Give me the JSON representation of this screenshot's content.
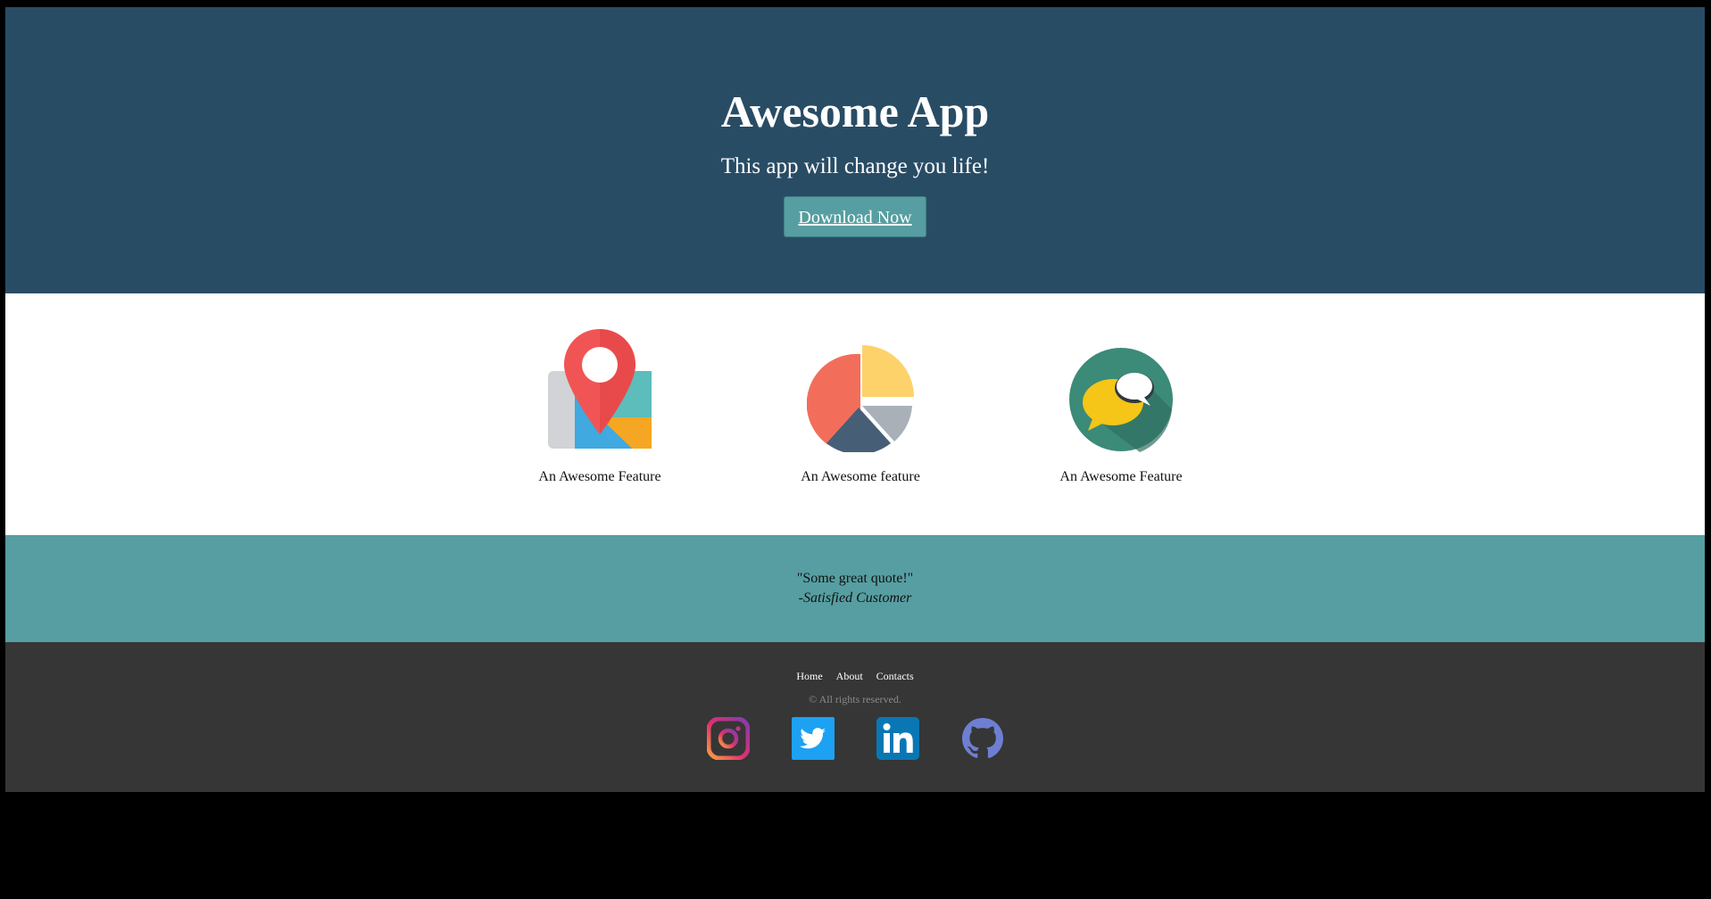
{
  "hero": {
    "title": "Awesome App",
    "subtitle": "This app will change you life!",
    "download_label": "Download Now"
  },
  "features": [
    {
      "label": "An Awesome Feature",
      "icon": "map-pin-icon"
    },
    {
      "label": "An Awesome feature",
      "icon": "pie-chart-icon"
    },
    {
      "label": "An Awesome Feature",
      "icon": "chat-bubbles-icon"
    }
  ],
  "testimonial": {
    "quote": "\"Some great quote!\"",
    "author": "-Satisfied Customer"
  },
  "footer": {
    "nav": [
      "Home",
      "About",
      "Contacts"
    ],
    "copyright": "© All rights reserved.",
    "socials": [
      "instagram-icon",
      "twitter-icon",
      "linkedin-icon",
      "github-icon"
    ]
  },
  "colors": {
    "hero_bg": "#294c65",
    "accent": "#569ea1",
    "footer_bg": "#363636",
    "background": "#000000"
  }
}
